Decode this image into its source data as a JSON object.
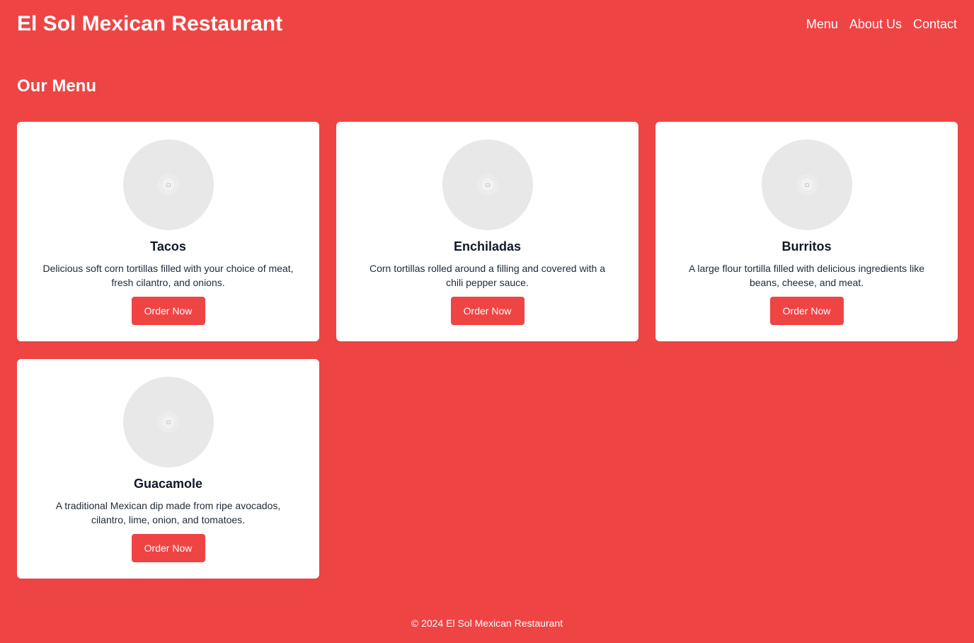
{
  "header": {
    "title": "El Sol Mexican Restaurant",
    "nav": [
      "Menu",
      "About Us",
      "Contact"
    ]
  },
  "menu": {
    "heading": "Our Menu",
    "items": [
      {
        "name": "Tacos",
        "description": "Delicious soft corn tortillas filled with your choice of meat, fresh cilantro, and onions.",
        "button": "Order Now",
        "image_icon": "image-placeholder-icon"
      },
      {
        "name": "Enchiladas",
        "description": "Corn tortillas rolled around a filling and covered with a chili pepper sauce.",
        "button": "Order Now",
        "image_icon": "image-placeholder-icon"
      },
      {
        "name": "Burritos",
        "description": "A large flour tortilla filled with delicious ingredients like beans, cheese, and meat.",
        "button": "Order Now",
        "image_icon": "image-placeholder-icon"
      },
      {
        "name": "Guacamole",
        "description": "A traditional Mexican dip made from ripe avocados, cilantro, lime, onion, and tomatoes.",
        "button": "Order Now",
        "image_icon": "image-placeholder-icon"
      }
    ]
  },
  "footer": {
    "text": "© 2024 El Sol Mexican Restaurant"
  },
  "colors": {
    "background": "#ef4444",
    "card": "#ffffff",
    "button": "#ef4444",
    "image_placeholder": "#e8e8e8",
    "title_text": "#111827"
  }
}
